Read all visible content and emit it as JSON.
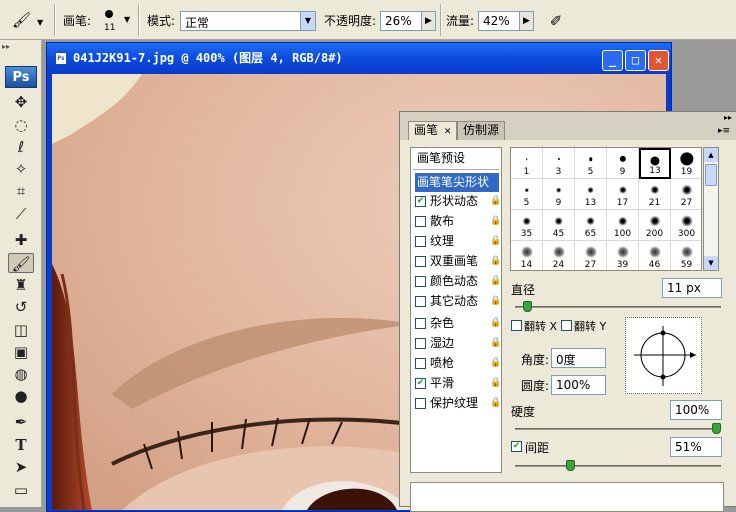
{
  "options_bar": {
    "brush_label": "画笔:",
    "brush_size": "11",
    "mode_label": "模式:",
    "mode_value": "正常",
    "opacity_label": "不透明度:",
    "opacity_value": "26%",
    "flow_label": "流量:",
    "flow_value": "42%"
  },
  "toolbox": {
    "logo": "Ps"
  },
  "document": {
    "title": "041J2K91-7.jpg @ 400% (图层 4, RGB/8#)"
  },
  "brush_panel": {
    "tabs": [
      "画笔",
      "仿制源"
    ],
    "presets_label": "画笔预设",
    "tip_shape_label": "画笔笔尖形状",
    "options": [
      {
        "label": "形状动态",
        "checked": true
      },
      {
        "label": "散布",
        "checked": false
      },
      {
        "label": "纹理",
        "checked": false
      },
      {
        "label": "双重画笔",
        "checked": false
      },
      {
        "label": "颜色动态",
        "checked": false
      },
      {
        "label": "其它动态",
        "checked": false
      },
      {
        "label": "杂色",
        "checked": false
      },
      {
        "label": "湿边",
        "checked": false
      },
      {
        "label": "喷枪",
        "checked": false
      },
      {
        "label": "平滑",
        "checked": true
      },
      {
        "label": "保护纹理",
        "checked": false
      }
    ],
    "brush_tips": [
      "1",
      "3",
      "5",
      "9",
      "13",
      "19",
      "5",
      "9",
      "13",
      "17",
      "21",
      "27",
      "35",
      "45",
      "65",
      "100",
      "200",
      "300",
      "14",
      "24",
      "27",
      "39",
      "46",
      "59"
    ],
    "selected_tip": "13",
    "diameter_label": "直径",
    "diameter_value": "11 px",
    "diameter_fraction": 0.04,
    "flip_x_label": "翻转 X",
    "flip_y_label": "翻转 Y",
    "angle_label": "角度:",
    "angle_value": "0度",
    "roundness_label": "圆度:",
    "roundness_value": "100%",
    "hardness_label": "硬度",
    "hardness_value": "100%",
    "hardness_fraction": 1.0,
    "spacing_label": "间距",
    "spacing_checked": true,
    "spacing_value": "51%",
    "spacing_fraction": 0.26
  }
}
